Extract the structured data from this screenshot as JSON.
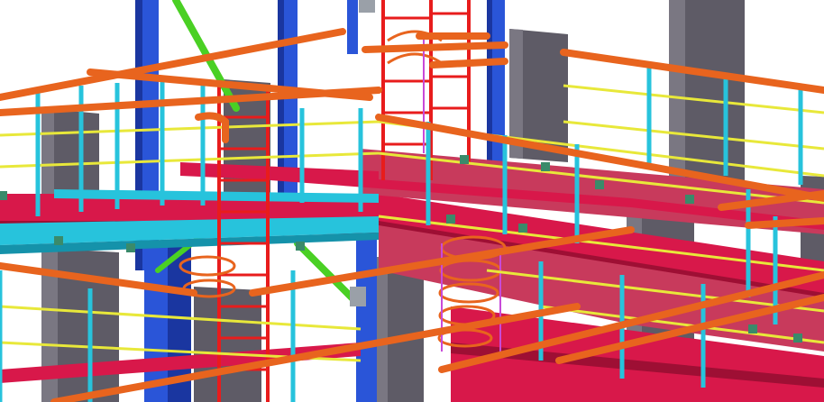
{
  "scene": {
    "description_visible_text": "",
    "palette": {
      "background": "#ffffff",
      "handrail": "#e8641e",
      "handrail_dark": "#b84a12",
      "post": "#27c3dc",
      "post_dark": "#1592aa",
      "mid_rail": "#e8e83a",
      "deck_beam": "#d8184a",
      "deck_beam_dark": "#9e0f34",
      "deck_top": "#c83a5c",
      "ladder": "#e81c1c",
      "column_blue": "#2a55d8",
      "column_blue_dark": "#1a36a0",
      "concrete": "#5e5b66",
      "concrete_light": "#7a7782",
      "brace_green": "#4ad024",
      "cage_magenta": "#c84ad8",
      "plate_grey": "#9aa0a8"
    }
  }
}
